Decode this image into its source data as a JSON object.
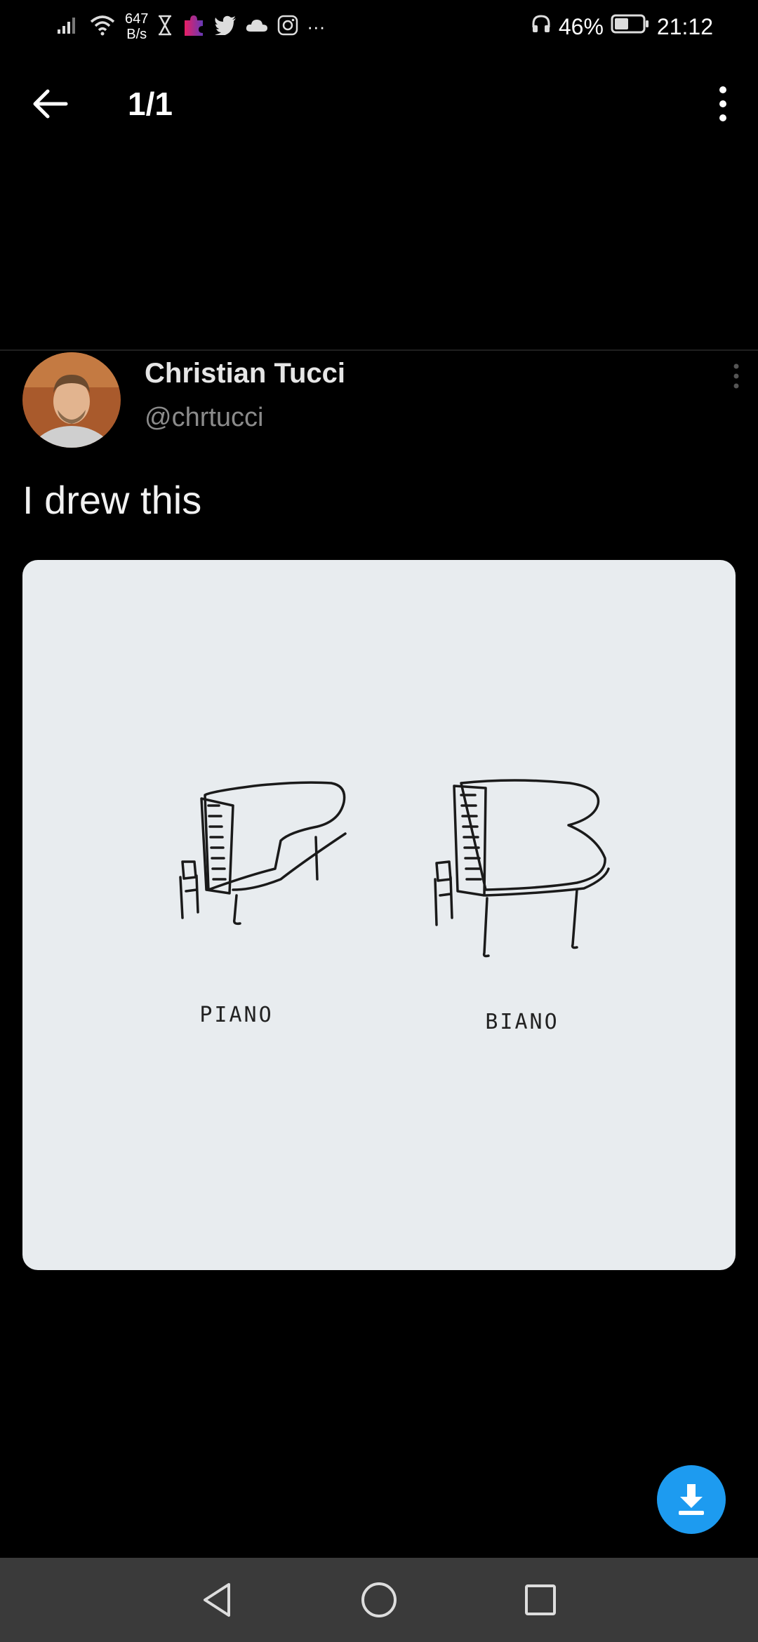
{
  "status_bar": {
    "net_speed_value": "647",
    "net_speed_unit": "B/s",
    "battery": "46%",
    "time": "21:12",
    "more": "···"
  },
  "app_bar": {
    "counter": "1/1"
  },
  "tweet": {
    "name": "Christian Tucci",
    "handle": "@chrtucci",
    "text": "I drew this",
    "drawing_labels": [
      "PIANO",
      "BIANO"
    ]
  },
  "colors": {
    "background": "#000000",
    "accent": "#1d9bf0",
    "nav_bar": "#3a3a3a"
  }
}
